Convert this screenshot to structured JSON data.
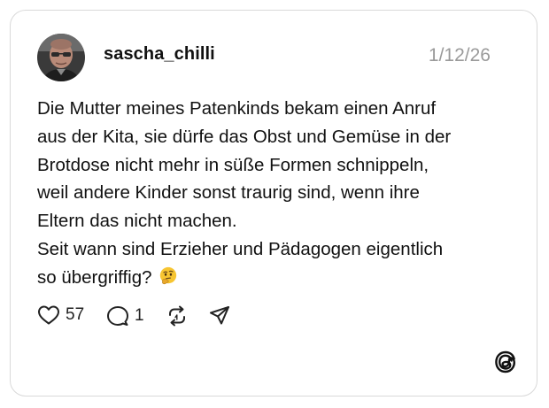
{
  "post": {
    "username": "sascha_chilli",
    "date": "1/12/26",
    "lines": [
      "Die Mutter meines Patenkinds bekam einen Anruf",
      "aus der Kita, sie dürfe das Obst und Gemüse in der",
      "Brotdose nicht mehr in süße Formen schnippeln,",
      "weil andere Kinder sonst traurig sind, wenn ihre",
      "Eltern das nicht machen.",
      "Seit wann sind Erzieher und Pädagogen eigentlich",
      "so übergriffig?"
    ],
    "emoji": "thinking-face"
  },
  "actions": {
    "likes": "57",
    "replies": "1",
    "icons": [
      "heart-icon",
      "comment-icon",
      "repost-icon",
      "share-icon"
    ]
  },
  "brand": {
    "logo": "threads-logo-icon"
  },
  "colors": {
    "text": "#111111",
    "muted": "#9a9a9a",
    "border": "#d9d9d9"
  }
}
